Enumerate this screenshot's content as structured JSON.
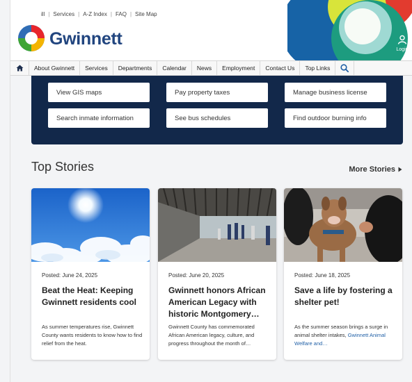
{
  "utility_links": [
    "ill",
    "Services",
    "A-Z Index",
    "FAQ",
    "Site Map"
  ],
  "brand": {
    "name": "Gwinnett"
  },
  "login_label": "Login",
  "nav": {
    "items": [
      "About Gwinnett",
      "Services",
      "Departments",
      "Calendar",
      "News",
      "Employment",
      "Contact Us",
      "Top Links"
    ]
  },
  "quick_links": {
    "row1": [
      "View GIS maps",
      "Pay property taxes",
      "Manage business license"
    ],
    "row2": [
      "Search inmate information",
      "See bus schedules",
      "Find outdoor burning info"
    ]
  },
  "stories": {
    "title": "Top Stories",
    "more_label": "More Stories",
    "items": [
      {
        "date": "Posted: June 24, 2025",
        "title": "Beat the Heat: Keeping Gwinnett residents cool",
        "text": "As summer temperatures rise, Gwinnett County wants residents to know how to find relief from the heat.",
        "link": ""
      },
      {
        "date": "Posted: June 20, 2025",
        "title": "Gwinnett honors African American Legacy with historic Montgomery…",
        "text": "Gwinnett County has commemorated African American legacy, culture, and progress throughout the month of…",
        "link": ""
      },
      {
        "date": "Posted: June 18, 2025",
        "title": "Save a life by fostering a shelter pet!",
        "text": "As the summer season brings a surge in animal shelter intakes,",
        "link": "Gwinnett Animal Welfare and…"
      }
    ]
  },
  "colors": {
    "navy": "#12284a",
    "brand_blue": "#21457f",
    "link": "#1f5fa6"
  },
  "icons": {
    "home": "home-icon",
    "search": "search-icon",
    "login": "user-icon",
    "more": "caret-right-icon"
  }
}
